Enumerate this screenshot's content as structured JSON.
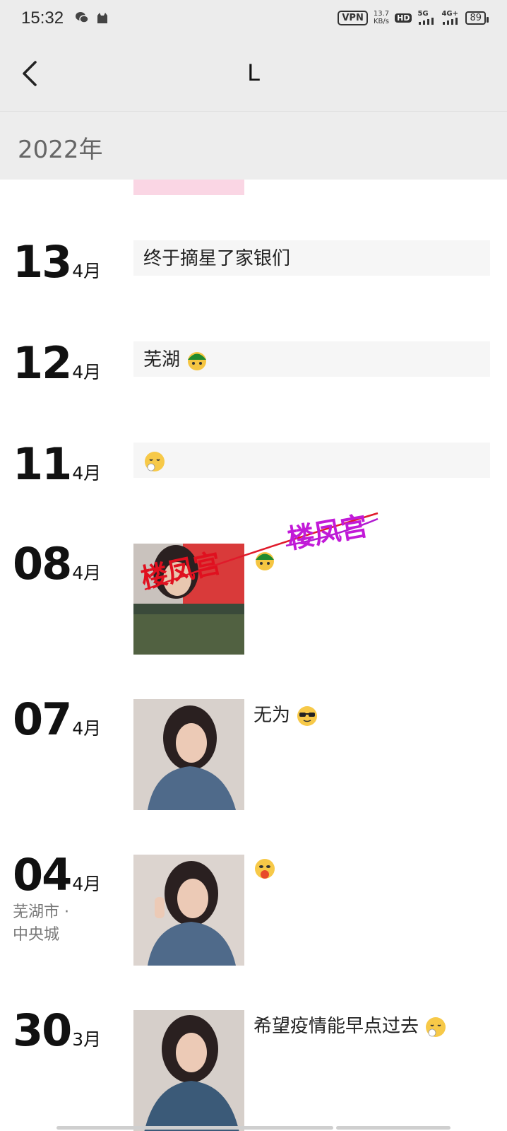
{
  "status": {
    "time": "15:32",
    "vpn": "VPN",
    "speed_value": "13.7",
    "speed_unit": "KB/s",
    "hd": "HD",
    "sim1": "5G",
    "sim2": "4G+",
    "battery": "89"
  },
  "nav": {
    "title": "L"
  },
  "year": "2022年",
  "entries": [
    {
      "day": "13",
      "month": "4月",
      "text": "终于摘星了家银们"
    },
    {
      "day": "12",
      "month": "4月",
      "text": "芜湖"
    },
    {
      "day": "11",
      "month": "4月",
      "text": ""
    },
    {
      "day": "08",
      "month": "4月",
      "text": "",
      "watermark": "楼凤宫"
    },
    {
      "day": "07",
      "month": "4月",
      "text": "无为"
    },
    {
      "day": "04",
      "month": "4月",
      "text": "",
      "location_line1": "芜湖市 ·",
      "location_line2": "中央城"
    },
    {
      "day": "30",
      "month": "3月",
      "text": "希望疫情能早点过去"
    }
  ]
}
